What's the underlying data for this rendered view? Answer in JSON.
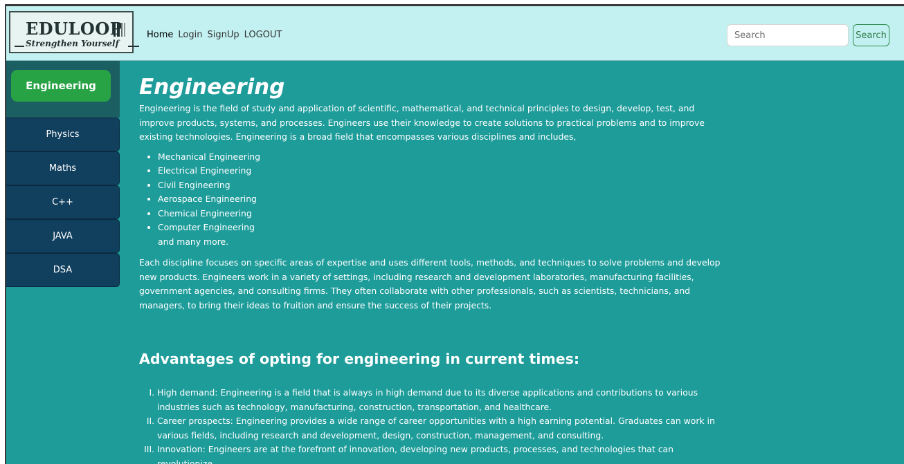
{
  "navbar": {
    "logo_title": "EDULOOP",
    "logo_tagline": "Strengthen Yourself",
    "links": [
      "Home",
      "Login",
      "SignUp",
      "LOGOUT"
    ],
    "search_placeholder": "Search",
    "search_button": "Search"
  },
  "sidebar": {
    "active": "Engineering",
    "items": [
      "Physics",
      "Maths",
      "C++",
      "JAVA",
      "DSA"
    ]
  },
  "main": {
    "title": "Engineering",
    "intro": "Engineering is the field of study and application of scientific, mathematical, and technical principles to design, develop, test, and improve products, systems, and processes. Engineers use their knowledge to create solutions to practical problems and to improve existing technologies. Engineering is a broad field that encompasses various disciplines and includes,",
    "fields": [
      "Mechanical Engineering",
      "Electrical Engineering",
      "Civil Engineering",
      "Aerospace Engineering",
      "Chemical Engineering",
      "Computer Engineering"
    ],
    "more": "and many more.",
    "paragraph2": "Each discipline focuses on specific areas of expertise and uses different tools, methods, and techniques to solve problems and develop new products. Engineers work in a variety of settings, including research and development laboratories, manufacturing facilities, government agencies, and consulting firms. They often collaborate with other professionals, such as scientists, technicians, and managers, to bring their ideas to fruition and ensure the success of their projects.",
    "advantages_title": "Advantages of opting for engineering in current times:",
    "advantages": [
      "High demand: Engineering is a field that is always in high demand due to its diverse applications and contributions to various industries such as technology, manufacturing, construction, transportation, and healthcare.",
      "Career prospects: Engineering provides a wide range of career opportunities with a high earning potential. Graduates can work in various fields, including research and development, design, construction, management, and consulting.",
      "Innovation: Engineers are at the forefront of innovation, developing new products, processes, and technologies that can revolutionize"
    ]
  },
  "colors": {
    "navbar_bg": "#c3f1f1",
    "page_bg": "#1e9c9a",
    "sidebar_head": "#1c5f63",
    "sidebar_item": "#113f5e",
    "active_green": "#27a245"
  }
}
